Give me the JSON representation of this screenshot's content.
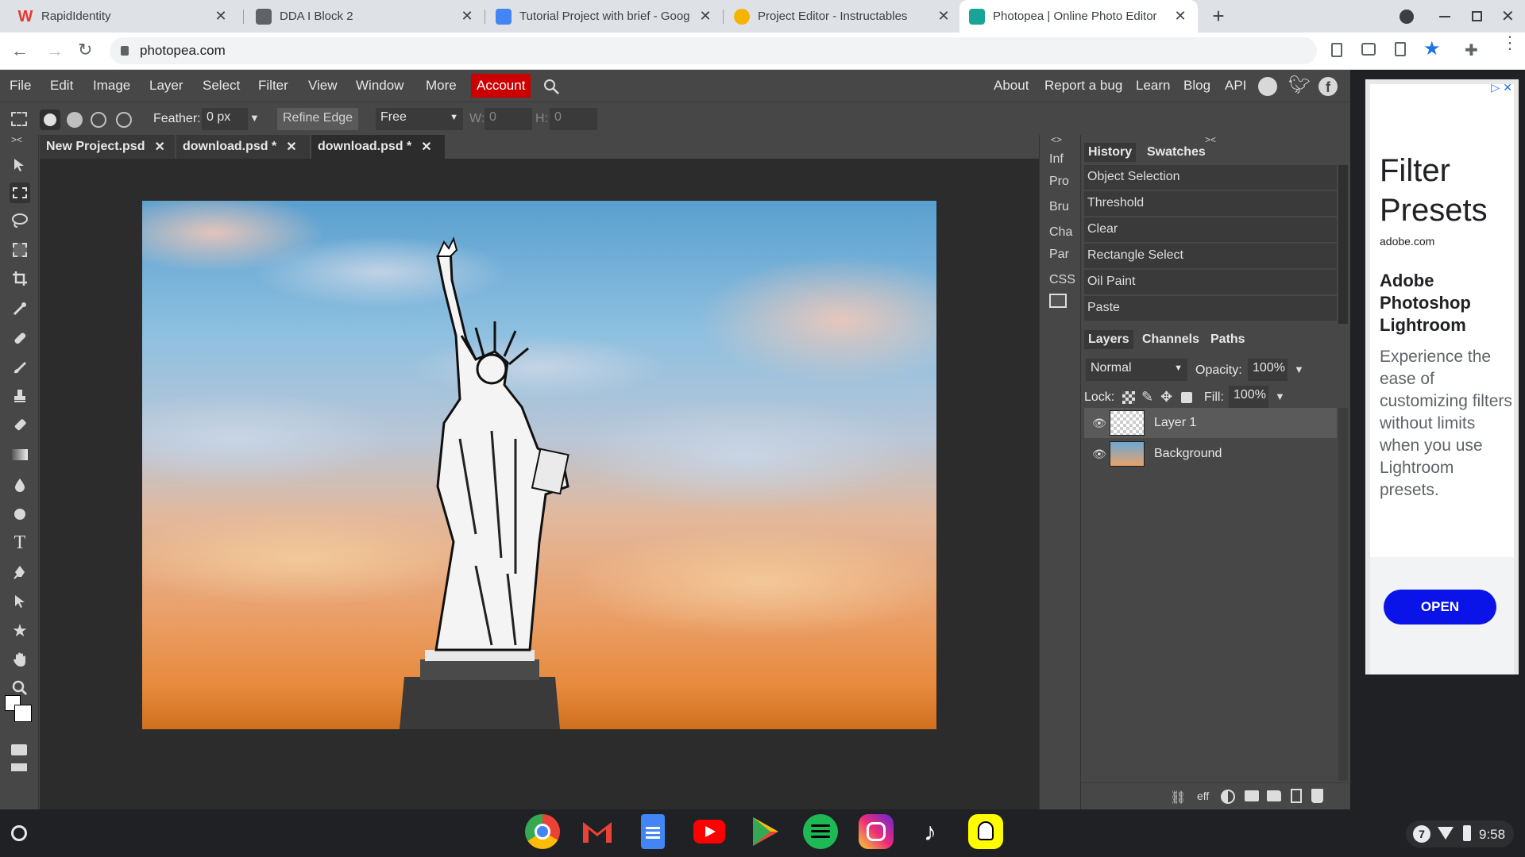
{
  "browser": {
    "tabs": [
      {
        "title": "RapidIdentity",
        "favicon_color": "#e53935"
      },
      {
        "title": "DDA I Block 2",
        "favicon_color": "#424242"
      },
      {
        "title": "Tutorial Project with brief - Goog",
        "favicon_color": "#4285f4"
      },
      {
        "title": "Project Editor - Instructables",
        "favicon_color": "#f4b400"
      },
      {
        "title": "Photopea | Online Photo Editor",
        "favicon_color": "#18a497"
      }
    ],
    "active_tab": 4,
    "url": "photopea.com"
  },
  "menu": {
    "items": [
      "File",
      "Edit",
      "Image",
      "Layer",
      "Select",
      "Filter",
      "View",
      "Window",
      "More"
    ],
    "account": "Account",
    "right_links": [
      "About",
      "Report a bug",
      "Learn",
      "Blog",
      "API"
    ],
    "account_color": "#cc0000"
  },
  "options": {
    "feather_label": "Feather:",
    "feather_value": "0 px",
    "refine_edge": "Refine Edge",
    "style_value": "Free",
    "w_label": "W:",
    "w_value": "0",
    "h_label": "H:",
    "h_value": "0"
  },
  "documents": [
    {
      "name": "New Project.psd"
    },
    {
      "name": "download.psd *"
    },
    {
      "name": "download.psd *"
    }
  ],
  "side_panels": [
    "Inf",
    "Pro",
    "Bru",
    "Cha",
    "Par",
    "CSS"
  ],
  "history": {
    "tabs": [
      "History",
      "Swatches"
    ],
    "items": [
      "Object Selection",
      "Threshold",
      "Clear",
      "Rectangle Select",
      "Oil Paint",
      "Paste"
    ]
  },
  "layers": {
    "tabs": [
      "Layers",
      "Channels",
      "Paths"
    ],
    "blend_mode": "Normal",
    "opacity_label": "Opacity:",
    "opacity": "100%",
    "lock_label": "Lock:",
    "fill_label": "Fill:",
    "fill": "100%",
    "items": [
      {
        "name": "Layer 1",
        "selected": true
      },
      {
        "name": "Background",
        "selected": false
      }
    ],
    "footer_eff": "eff"
  },
  "ad": {
    "headline": "Filter Presets",
    "domain": "adobe.com",
    "product": "Adobe Photoshop Lightroom",
    "body": "Experience the ease of customizing filters without limits when you use Lightroom presets.",
    "cta": "OPEN"
  },
  "shelf": {
    "apps": [
      "Chrome",
      "Gmail",
      "Docs",
      "YouTube",
      "Play Store",
      "Spotify",
      "Instagram",
      "TikTok",
      "Snapchat"
    ],
    "notification_count": "7",
    "time": "9:58"
  }
}
